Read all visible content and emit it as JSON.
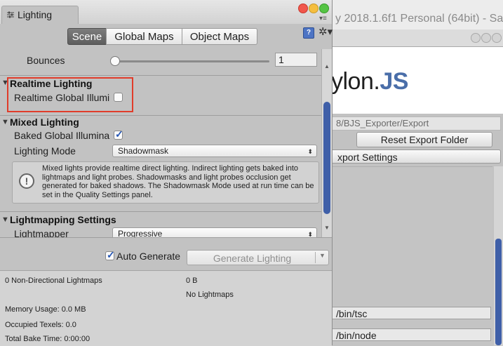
{
  "background_window": {
    "title": "y 2018.1.6f1 Personal (64bit) - Sa",
    "logo_text": "ylon.",
    "logo_accent": "JS",
    "export_path": "8/BJS_Exporter/Export",
    "reset_button": "Reset Export Folder",
    "export_settings": "xport Settings",
    "tsc_path": "/bin/tsc",
    "node_path": "/bin/node"
  },
  "window": {
    "tab_title": "Lighting",
    "tab_icon": "lighting-icon",
    "traffic_lights": {
      "close": "#f1564b",
      "minimize": "#f5be3f",
      "zoom": "#55c444"
    }
  },
  "segments": {
    "scene": "Scene",
    "global_maps": "Global Maps",
    "object_maps": "Object Maps",
    "active": "Scene"
  },
  "bounces": {
    "label": "Bounces",
    "value": "1"
  },
  "realtime": {
    "header": "Realtime Lighting",
    "gi_label": "Realtime Global Illumi",
    "gi_checked": false,
    "highlight_color": "#e03c2a"
  },
  "mixed": {
    "header": "Mixed Lighting",
    "baked_label": "Baked Global Illumina",
    "baked_checked": true,
    "mode_label": "Lighting Mode",
    "mode_value": "Shadowmask",
    "info": "Mixed lights provide realtime direct lighting. Indirect lighting gets baked into lightmaps and light probes. Shadowmasks and light probes occlusion get generated for baked shadows. The Shadowmask Mode used at run time can be set in the Quality Settings panel."
  },
  "lightmapping": {
    "header": "Lightmapping Settings",
    "lightmapper_label": "Lightmapper",
    "lightmapper_value": "Progressive"
  },
  "generate": {
    "auto_label": "Auto Generate",
    "auto_checked": true,
    "button": "Generate Lighting"
  },
  "stats": {
    "lightmaps": "0 Non-Directional Lightmaps",
    "size": "0 B",
    "no_lightmaps": "No Lightmaps",
    "memory": "Memory Usage: 0.0 MB",
    "texels": "Occupied Texels: 0.0",
    "bake_time": "Total Bake Time: 0:00:00"
  },
  "accent_color": "#3f5fa8"
}
